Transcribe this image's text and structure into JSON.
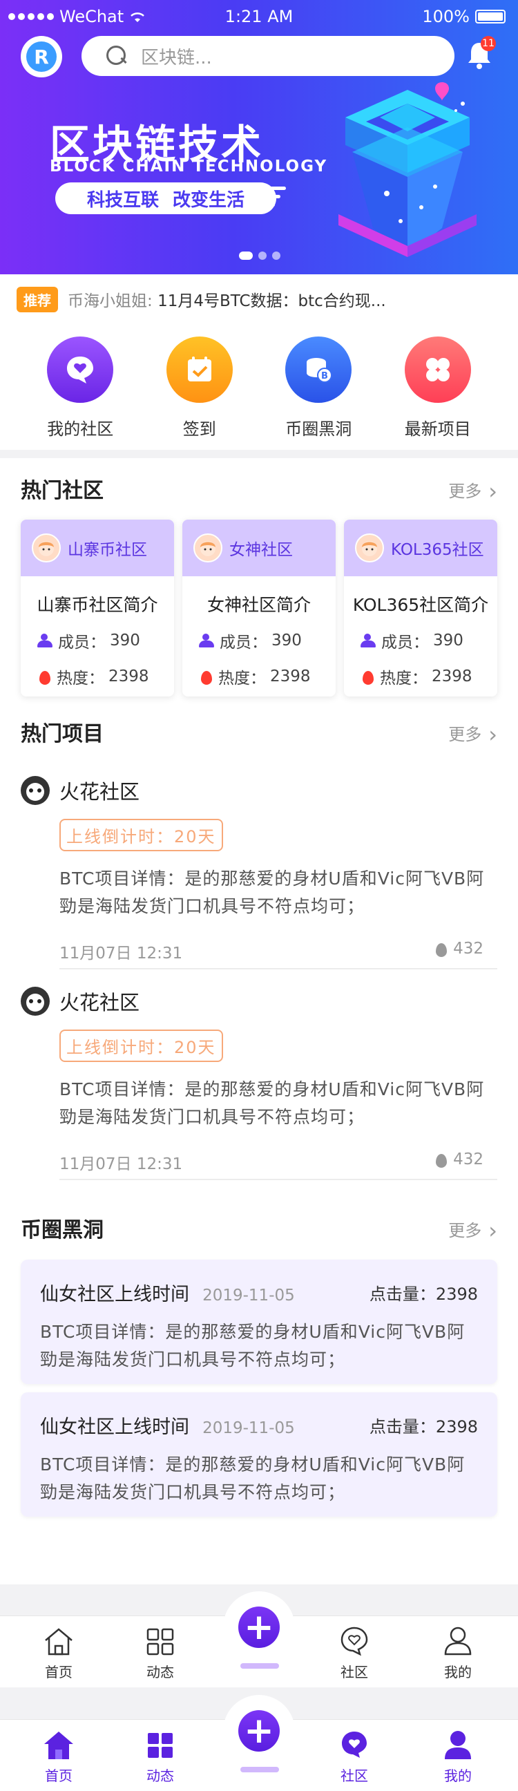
{
  "status": {
    "carrier": "WeChat",
    "time": "1:21 AM",
    "battery": "100%"
  },
  "header": {
    "search_placeholder": "区块链...",
    "notif_count": "11",
    "logo_letter": "R"
  },
  "banner": {
    "title": "区块链技术",
    "subtitle": "BLOCK CHAIN TECHNOLOGY",
    "slogan_1": "科技互联",
    "slogan_2": "改变生活"
  },
  "ticker": {
    "tag": "推荐",
    "author": "币海小姐姐:",
    "text": "11月4号BTC数据：btc合约现..."
  },
  "shortcuts": [
    {
      "label": "我的社区",
      "icon": "chat-heart-icon",
      "color": "#7a35f0"
    },
    {
      "label": "签到",
      "icon": "calendar-check-icon",
      "color": "#ffa319"
    },
    {
      "label": "币圈黑洞",
      "icon": "coins-icon",
      "color": "#3a6ef5"
    },
    {
      "label": "最新项目",
      "icon": "clover-icon",
      "color": "#ff5562"
    }
  ],
  "hot_communities": {
    "title": "热门社区",
    "more": "更多",
    "cards": [
      {
        "name": "山寨币社区",
        "intro": "山寨币社区简介",
        "members_label": "成员：",
        "members": "390",
        "heat_label": "热度：",
        "heat": "2398"
      },
      {
        "name": "女神社区",
        "intro": "女神社区简介",
        "members_label": "成员：",
        "members": "390",
        "heat_label": "热度：",
        "heat": "2398"
      },
      {
        "name": "KOL365社区",
        "intro": "KOL365社区简介",
        "members_label": "成员：",
        "members": "390",
        "heat_label": "热度：",
        "heat": "2398"
      }
    ]
  },
  "hot_projects": {
    "title": "热门项目",
    "more": "更多",
    "items": [
      {
        "name": "火花社区",
        "countdown": "上线倒计时：20天",
        "desc": "BTC项目详情：是的那慈爱的身材U盾和Vic阿飞VB阿勁是海陆发货门口机具号不符点均可；",
        "time": "11月07日 12:31",
        "heat": "432"
      },
      {
        "name": "火花社区",
        "countdown": "上线倒计时：20天",
        "desc": "BTC项目详情：是的那慈爱的身材U盾和Vic阿飞VB阿勁是海陆发货门口机具号不符点均可；",
        "time": "11月07日 12:31",
        "heat": "432"
      }
    ]
  },
  "blackhole": {
    "title": "币圈黑洞",
    "more": "更多",
    "items": [
      {
        "title": "仙女社区上线时间",
        "date": "2019-11-05",
        "clicks": "点击量：2398",
        "desc": "BTC项目详情：是的那慈爱的身材U盾和Vic阿飞VB阿勁是海陆发货门口机具号不符点均可；"
      },
      {
        "title": "仙女社区上线时间",
        "date": "2019-11-05",
        "clicks": "点击量：2398",
        "desc": "BTC项目详情：是的那慈爱的身材U盾和Vic阿飞VB阿勁是海陆发货门口机具号不符点均可；"
      }
    ]
  },
  "tabbar_outline": {
    "home": "首页",
    "feed": "动态",
    "community": "社区",
    "mine": "我的"
  },
  "tabbar_filled": {
    "home": "首页",
    "feed": "动态",
    "community": "社区",
    "mine": "我的"
  },
  "colors": {
    "brand": "#5b22e0",
    "banner_start": "#7b2ff7",
    "banner_end": "#2f6ff6",
    "accent_orange": "#ff9b1a"
  }
}
